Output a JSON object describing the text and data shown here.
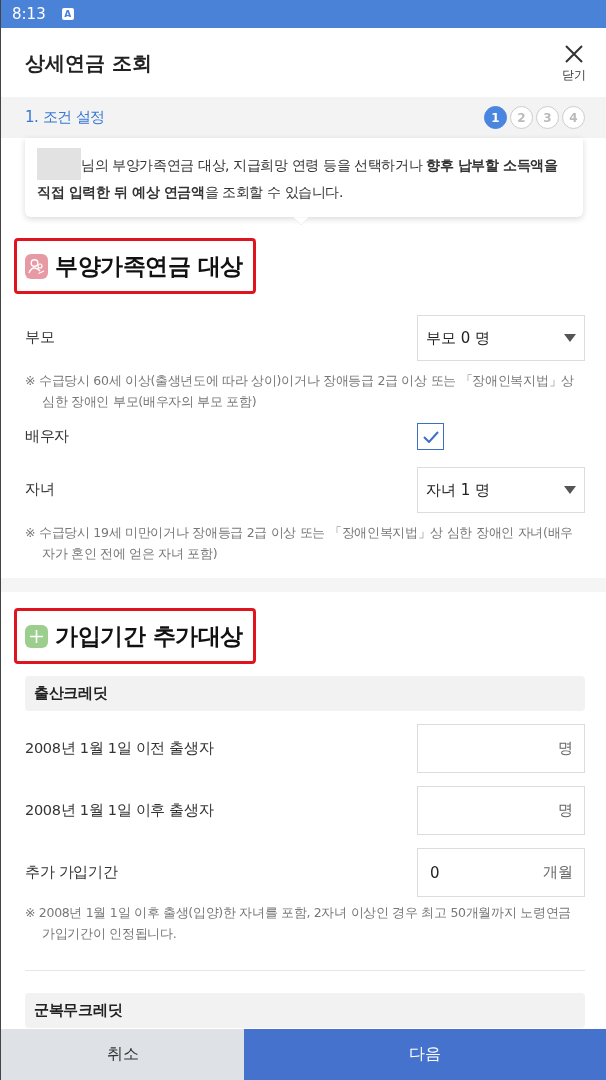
{
  "status_bar": {
    "time": "8:13",
    "badge": "A"
  },
  "header": {
    "title": "상세연금 조회",
    "close_label": "닫기"
  },
  "steps": {
    "current_label": "1. 조건 설정",
    "items": [
      {
        "label": "1",
        "selected": true
      },
      {
        "label": "2",
        "selected": false
      },
      {
        "label": "3",
        "selected": false
      },
      {
        "label": "4",
        "selected": false
      }
    ]
  },
  "intro": {
    "text": "님의 부양가족연금 대상, 지급희망 연령 등을 선택하거나 **향후 납부할 소득액을 직접 입력한 뒤 예상 연금액**을 조회할 수 있습니다."
  },
  "sections": [
    {
      "kind": "dependents",
      "title": "부양가족연금 대상",
      "highlighted": true,
      "items": [
        {
          "kind": "select",
          "label": "부모",
          "value": "부모 0 명"
        },
        {
          "kind": "note",
          "text": "※ 수급당시 60세 이상(출생년도에 따라 상이)이거나 장애등급 2급 이상 또는 「장애인복지법」상 심한 장애인 부모(배우자의 부모 포함)"
        },
        {
          "kind": "checkbox",
          "label": "배우자",
          "checked": true
        },
        {
          "kind": "select",
          "label": "자녀",
          "value": "자녀 1 명"
        },
        {
          "kind": "note",
          "text": "※ 수급당시 19세 미만이거나 장애등급 2급 이상 또는 「장애인복지법」상 심한 장애인 자녀(배우자가 혼인 전에 얻은 자녀 포함)"
        }
      ]
    },
    {
      "kind": "credits",
      "title": "가입기간 추가대상",
      "highlighted": true,
      "items": [
        {
          "kind": "subheader",
          "text": "출산크레딧"
        },
        {
          "kind": "input",
          "label": "2008년 1월 1일 이전 출생자",
          "unit": "명"
        },
        {
          "kind": "input",
          "label": "2008년 1월 1일 이후 출생자",
          "unit": "명"
        },
        {
          "kind": "input",
          "label": "추가 가입기간",
          "value": "0",
          "unit": "개월"
        },
        {
          "kind": "note",
          "text": "※ 2008년 1월 1일 이후 출생(입양)한 자녀를 포함, 2자녀 이상인 경우 최고 50개월까지 노령연금 가입기간이 인정됩니다."
        },
        {
          "kind": "divider"
        },
        {
          "kind": "subheader",
          "text": "군복무크레딧"
        }
      ]
    }
  ],
  "footer": {
    "buttons": [
      {
        "label": "취소",
        "kind": "secondary"
      },
      {
        "label": "다음",
        "kind": "primary"
      }
    ]
  }
}
